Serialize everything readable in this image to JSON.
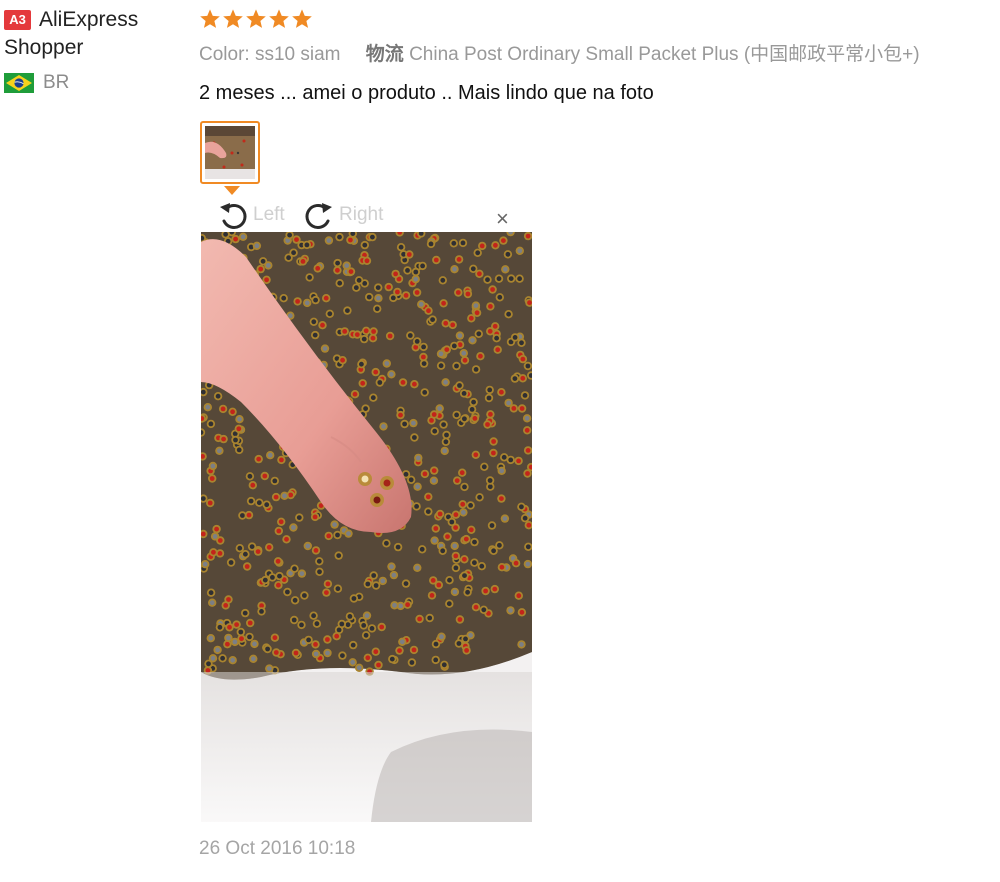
{
  "reviewer": {
    "badge": "A3",
    "name": "AliExpress Shopper",
    "country_code": "BR",
    "flag_icon": "brazil-flag-icon"
  },
  "review": {
    "rating": 5,
    "star_color": "#f08a24",
    "color_label": "Color:",
    "color_value": "ss10 siam",
    "logistics_label": "物流",
    "logistics_value": "China Post Ordinary Small Packet Plus (中国邮政平常小包+)",
    "text": "2 meses ... amei o produto .. Mais lindo que na foto",
    "date": "26 Oct 2016 10:18"
  },
  "viewer": {
    "rotate_left_label": "Left",
    "rotate_right_label": "Right",
    "close_label": "×",
    "accent": "#f08a24"
  }
}
